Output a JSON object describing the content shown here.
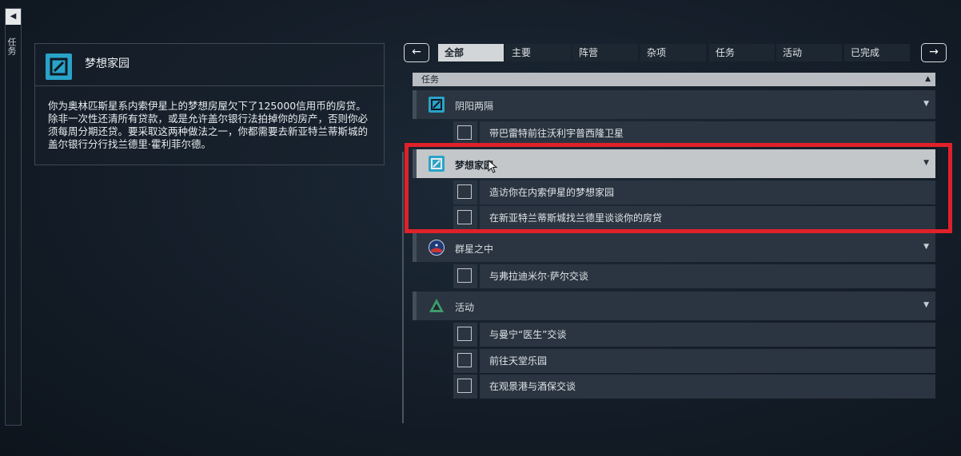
{
  "sidebar": {
    "collapse_icon": "triangle-left-icon",
    "label": "任务"
  },
  "detail": {
    "title": "梦想家园",
    "description": "你为奥林匹斯星系内索伊星上的梦想房屋欠下了125000信用币的房贷。除非一次性还清所有贷款，或是允许盖尔银行法拍掉你的房产，否则你必须每周分期还贷。要采取这两种做法之一，你都需要去新亚特兰蒂斯城的盖尔银行分行找兰德里·霍利菲尔德。"
  },
  "nav": {
    "prev": "←",
    "next": "→",
    "tabs": [
      "全部",
      "主要",
      "阵营",
      "杂项",
      "任务",
      "活动",
      "已完成"
    ]
  },
  "sort": {
    "label": "任务",
    "icon": "sort-updown-icon"
  },
  "groups": [
    {
      "label": "阴阳两隔",
      "icon": "mission-icon",
      "items": [
        "带巴雷特前往沃利宇普西隆卫星"
      ]
    },
    {
      "label": "梦想家园",
      "icon": "mission-icon",
      "items": [
        "造访你在内索伊星的梦想家园",
        "在新亚特兰蒂斯城找兰德里谈谈你的房贷"
      ]
    },
    {
      "label": "群星之中",
      "icon": "constellation-icon",
      "items": [
        "与弗拉迪米尔·萨尔交谈"
      ]
    },
    {
      "label": "活动",
      "icon": "activity-icon",
      "items": [
        "与曼宁“医生”交谈",
        "前往天堂乐园",
        "在观景港与酒保交谈"
      ]
    }
  ],
  "colors": {
    "accent": "#2aa3c8",
    "highlight": "#e02129",
    "selected_row": "#c4c7ca"
  }
}
